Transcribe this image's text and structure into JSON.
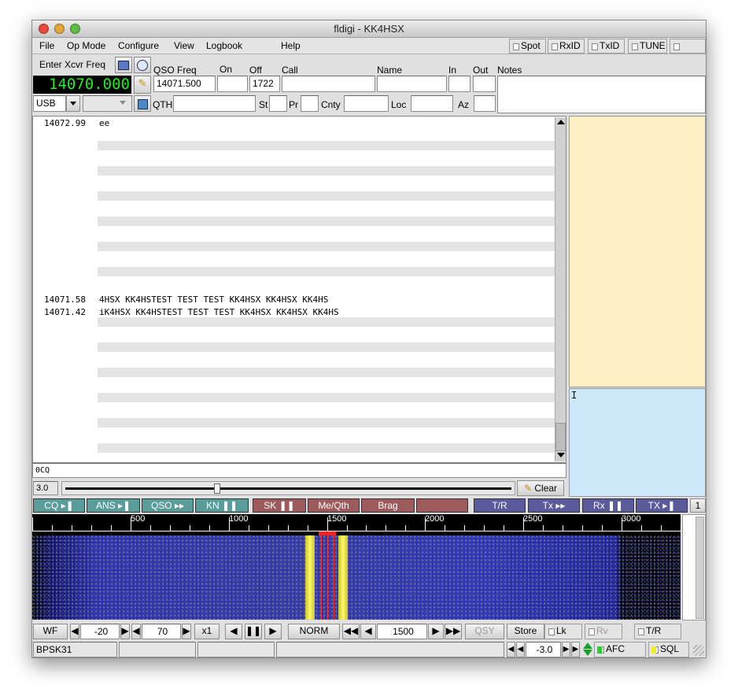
{
  "window": {
    "title": "fldigi - KK4HSX"
  },
  "menu": {
    "file": "File",
    "op_mode": "Op Mode",
    "configure": "Configure",
    "view": "View",
    "logbook": "Logbook",
    "help": "Help",
    "spot": "Spot",
    "rxid": "RxID",
    "txid": "TxID",
    "tune": "TUNE"
  },
  "rig": {
    "enter_xcvr_freq": "Enter Xcvr Freq",
    "freq_display": "14070.000",
    "mode": "USB"
  },
  "log": {
    "qso_freq_label": "QSO Freq",
    "qso_freq": "14071.500",
    "on_label": "On",
    "on": "",
    "off_label": "Off",
    "off": "1722",
    "call_label": "Call",
    "call": "",
    "name_label": "Name",
    "name": "",
    "in_label": "In",
    "in": "",
    "out_label": "Out",
    "out": "",
    "notes_label": "Notes",
    "notes": "",
    "qth_label": "QTH",
    "qth": "",
    "st_label": "St",
    "st": "",
    "pr_label": "Pr",
    "pr": "",
    "cnty_label": "Cnty",
    "cnty": "",
    "loc_label": "Loc",
    "loc": "",
    "az_label": "Az",
    "az": ""
  },
  "rx_text": {
    "lines": [
      {
        "freq": "14072.99",
        "text": "ee"
      },
      {
        "freq": "14071.58",
        "text": "4HSX KK4HSTEST TEST TEST KK4HSX KK4HSX KK4HS"
      },
      {
        "freq": "14071.42",
        "text": "iK4HSX KK4HSTEST TEST TEST KK4HSX KK4HSX KK4HS"
      }
    ]
  },
  "tx": {
    "text": "0CQ",
    "squelch_value": "3.0",
    "squelch_fraction": 0.34,
    "clear_label": "Clear",
    "cursor": "I"
  },
  "macros": {
    "left": [
      "CQ",
      "ANS",
      "QSO",
      "KN",
      "SK",
      "Me/Qth",
      "Brag",
      ""
    ],
    "right": [
      "T/R",
      "Tx",
      "Rx",
      "TX"
    ],
    "bank": "1"
  },
  "waterfall": {
    "scale": [
      "500",
      "1000",
      "1500",
      "2000",
      "2500",
      "3000"
    ],
    "scale_min_hz": 0,
    "scale_max_hz": 3300,
    "carrier_hz": 1500,
    "mode_btn": "WF",
    "ref_level": "-20",
    "range": "70",
    "speed": "x1",
    "norm": "NORM",
    "audio_freq": "1500",
    "qsy": "QSY",
    "store": "Store",
    "lk": "Lk",
    "rv": "Rv",
    "tr": "T/R"
  },
  "status": {
    "modem": "BPSK31",
    "field2": "",
    "field3": "",
    "field4": "",
    "s2n": "-3.0",
    "afc": "AFC",
    "sql": "SQL"
  },
  "colors": {
    "freq_display_fg": "#1ef01e",
    "freq_display_bg": "#000000",
    "rx_bg": "#ffffff",
    "tx_bg": "#fff0c4",
    "tx2_bg": "#cce8fa",
    "macro_teal": "#5a9c9c",
    "macro_red": "#9c5a5a",
    "macro_blue": "#5a5a9c"
  }
}
